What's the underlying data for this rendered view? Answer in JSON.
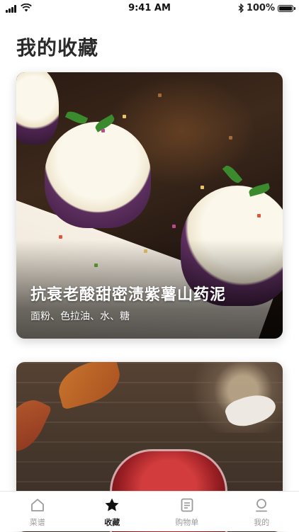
{
  "status_bar": {
    "time": "9:41 AM",
    "battery": "100%",
    "battery_level": 1.0
  },
  "page": {
    "title": "我的收藏"
  },
  "favorites": [
    {
      "title": "抗衰老酸甜密渍紫薯山药泥",
      "ingredients": "面粉、色拉油、水、糖"
    }
  ],
  "tabbar": {
    "items": [
      {
        "label": "菜谱",
        "icon": "home-icon"
      },
      {
        "label": "收藏",
        "icon": "star-icon",
        "active": true
      },
      {
        "label": "购物单",
        "icon": "list-icon"
      },
      {
        "label": "我的",
        "icon": "person-icon"
      }
    ]
  }
}
